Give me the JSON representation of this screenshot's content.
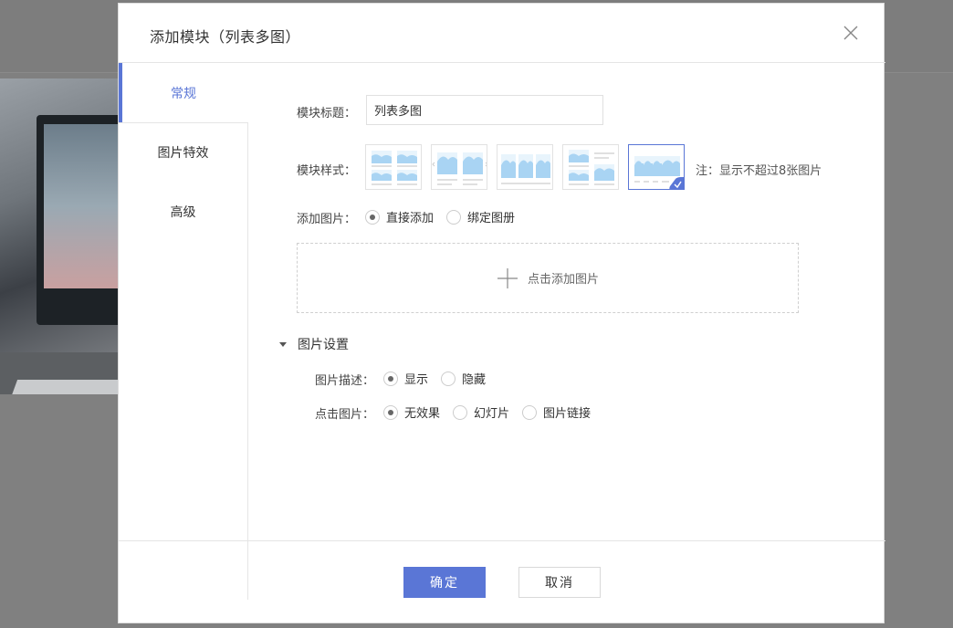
{
  "modal": {
    "title": "添加模块（列表多图）"
  },
  "sidebar": {
    "items": [
      {
        "label": "常规",
        "active": true
      },
      {
        "label": "图片特效",
        "active": false
      },
      {
        "label": "高级",
        "active": false
      }
    ]
  },
  "form": {
    "title_label": "模块标题：",
    "title_value": "列表多图",
    "style_label": "模块样式：",
    "style_note": "注：显示不超过8张图片",
    "style_options": [
      {
        "id": "style-1",
        "selected": false
      },
      {
        "id": "style-2",
        "selected": false
      },
      {
        "id": "style-3",
        "selected": false
      },
      {
        "id": "style-4",
        "selected": false
      },
      {
        "id": "style-5",
        "selected": true
      }
    ],
    "add_image_label": "添加图片：",
    "add_image_options": [
      {
        "label": "直接添加",
        "checked": true
      },
      {
        "label": "绑定图册",
        "checked": false
      }
    ],
    "upload_text": "点击添加图片"
  },
  "image_settings": {
    "section_label": "图片设置",
    "desc_label": "图片描述：",
    "desc_options": [
      {
        "label": "显示",
        "checked": true
      },
      {
        "label": "隐藏",
        "checked": false
      }
    ],
    "click_label": "点击图片：",
    "click_options": [
      {
        "label": "无效果",
        "checked": true
      },
      {
        "label": "幻灯片",
        "checked": false
      },
      {
        "label": "图片链接",
        "checked": false
      }
    ]
  },
  "footer": {
    "ok_label": "确定",
    "cancel_label": "取消"
  },
  "colors": {
    "accent": "#5a76d6",
    "thumb_fill": "#a9d4f3",
    "thumb_line": "#d6d6d6"
  },
  "icons": {
    "close": "close-icon",
    "plus": "plus-icon",
    "caret": "caret-down-icon",
    "check": "check-badge-icon"
  }
}
